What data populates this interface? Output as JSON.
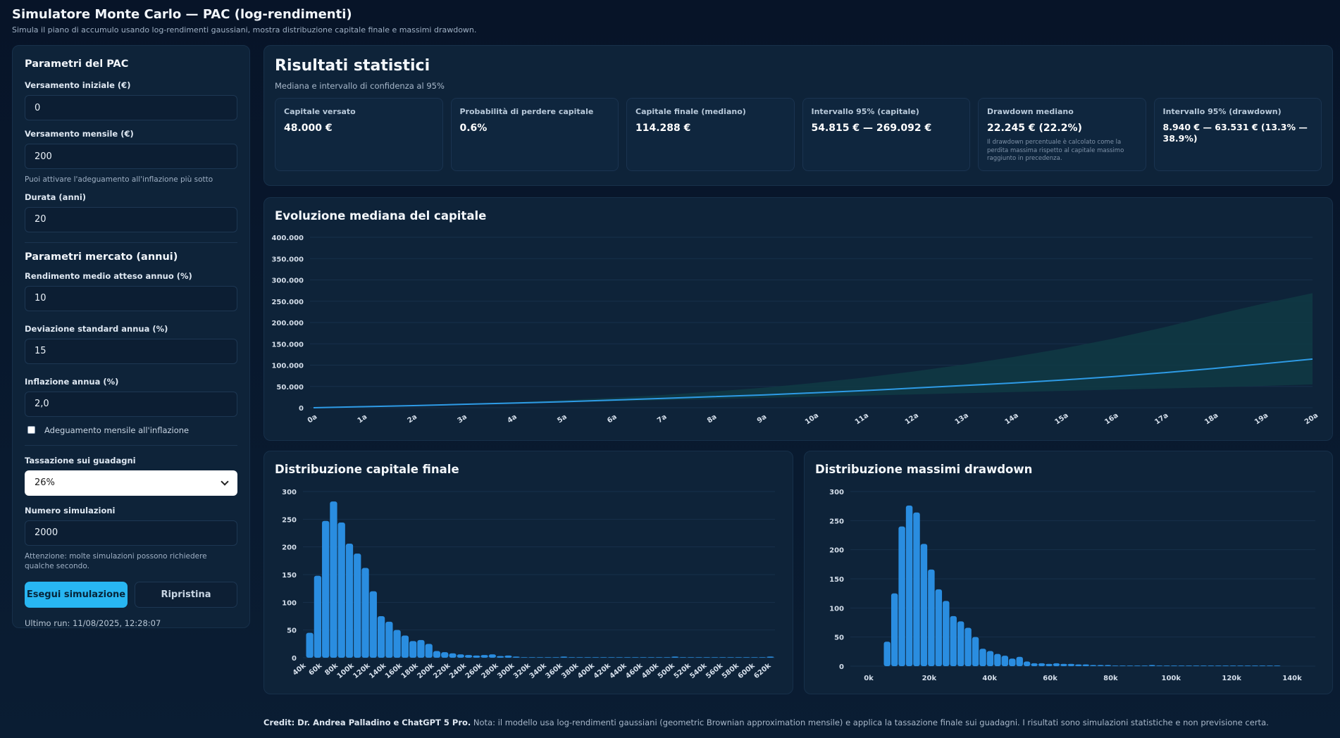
{
  "header": {
    "title": "Simulatore Monte Carlo — PAC (log-rendimenti)",
    "subtitle": "Simula il piano di accumulo usando log-rendimenti gaussiani, mostra distribuzione capitale finale e massimi drawdown."
  },
  "sidebar": {
    "pac_title": "Parametri del PAC",
    "initial_label": "Versamento iniziale (€)",
    "initial_value": "0",
    "monthly_label": "Versamento mensile (€)",
    "monthly_value": "200",
    "monthly_hint": "Puoi attivare l'adeguamento all'inflazione più sotto",
    "duration_label": "Durata (anni)",
    "duration_value": "20",
    "market_title": "Parametri mercato (annui)",
    "return_label": "Rendimento medio atteso annuo (%)",
    "return_value": "10",
    "stddev_label": "Deviazione standard annua (%)",
    "stddev_value": "15",
    "inflation_label": "Inflazione annua (%)",
    "inflation_value": "2,0",
    "inflation_adjust_label": "Adeguamento mensile all'inflazione",
    "tax_label": "Tassazione sui guadagni",
    "tax_value": "26%",
    "sims_label": "Numero simulazioni",
    "sims_value": "2000",
    "sims_hint": "Attenzione: molte simulazioni possono richiedere qualche secondo.",
    "run_button": "Esegui simulazione",
    "reset_button": "Ripristina",
    "last_run": "Ultimo run: 11/08/2025, 12:28:07"
  },
  "stats": {
    "title": "Risultati statistici",
    "subtitle": "Mediana e intervallo di confidenza al 95%",
    "cards": [
      {
        "label": "Capitale versato",
        "value": "48.000 €",
        "note": ""
      },
      {
        "label": "Probabilità di perdere capitale",
        "value": "0.6%",
        "note": ""
      },
      {
        "label": "Capitale finale (mediano)",
        "value": "114.288 €",
        "note": ""
      },
      {
        "label": "Intervallo 95% (capitale)",
        "value": "54.815 € — 269.092 €",
        "note": ""
      },
      {
        "label": "Drawdown mediano",
        "value": "22.245 € (22.2%)",
        "note": "Il drawdown percentuale è calcolato come la perdita massima rispetto al capitale massimo raggiunto in precedenza."
      },
      {
        "label": "Intervallo 95% (drawdown)",
        "value": "8.940 € — 63.531 € (13.3% — 38.9%)",
        "note": ""
      }
    ]
  },
  "chart_data": [
    {
      "type": "area",
      "title": "Evoluzione mediana del capitale",
      "x": [
        "0a",
        "1a",
        "2a",
        "3a",
        "4a",
        "5a",
        "6a",
        "7a",
        "8a",
        "9a",
        "10a",
        "11a",
        "12a",
        "13a",
        "14a",
        "15a",
        "16a",
        "17a",
        "18a",
        "19a",
        "20a"
      ],
      "series": [
        {
          "values": [
            0,
            2500,
            5000,
            8000,
            11000,
            14000,
            18000,
            22000,
            26000,
            30000,
            35000,
            40000,
            46000,
            52000,
            58000,
            65000,
            73000,
            82000,
            92000,
            103000,
            114288
          ]
        }
      ],
      "band_lower": [
        0,
        2400,
        4700,
        7200,
        9800,
        12300,
        15000,
        17600,
        20200,
        23000,
        25800,
        28500,
        31200,
        34000,
        36700,
        39500,
        42300,
        45000,
        48000,
        51000,
        54815
      ],
      "band_upper": [
        0,
        2650,
        5700,
        9200,
        13300,
        18000,
        23500,
        30000,
        38000,
        47000,
        58000,
        70500,
        85000,
        101000,
        119000,
        139000,
        162000,
        188000,
        217000,
        244000,
        269092
      ],
      "yticks": [
        "0",
        "50.000",
        "100.000",
        "150.000",
        "200.000",
        "250.000",
        "300.000",
        "350.000",
        "400.000"
      ],
      "ylim": [
        0,
        400000
      ],
      "colors": {
        "line": "#2e9be6",
        "band": "#0f3a44"
      }
    },
    {
      "type": "bar",
      "title": "Distribuzione capitale finale",
      "categories": [
        "40k",
        "60k",
        "80k",
        "100k",
        "120k",
        "140k",
        "160k",
        "180k",
        "200k",
        "220k",
        "240k",
        "260k",
        "280k",
        "300k",
        "320k",
        "340k",
        "360k",
        "380k",
        "400k",
        "420k",
        "440k",
        "460k",
        "480k",
        "500k",
        "520k",
        "540k",
        "560k",
        "580k",
        "600k",
        "620k"
      ],
      "values": [
        45,
        148,
        247,
        282,
        244,
        206,
        188,
        162,
        120,
        75,
        65,
        50,
        40,
        30,
        32,
        25,
        12,
        10,
        8,
        6,
        5,
        4,
        5,
        6,
        3,
        4,
        2,
        1,
        1,
        1,
        1,
        1,
        2,
        1,
        1,
        1,
        1,
        1,
        1,
        1,
        1,
        1,
        1,
        1,
        1,
        1,
        2,
        1,
        1,
        1,
        1,
        1,
        1,
        1,
        1,
        1,
        1,
        1,
        2
      ],
      "yticks": [
        "0",
        "50",
        "100",
        "150",
        "200",
        "250",
        "300"
      ],
      "ylim": [
        0,
        300
      ],
      "colors": {
        "bar": "#2a8de0"
      }
    },
    {
      "type": "bar",
      "title": "Distribuzione massimi drawdown",
      "categories": [
        "0k",
        "20k",
        "40k",
        "60k",
        "80k",
        "100k",
        "120k",
        "140k"
      ],
      "values": [
        42,
        125,
        240,
        276,
        264,
        210,
        166,
        132,
        112,
        86,
        77,
        66,
        50,
        30,
        26,
        21,
        18,
        13,
        16,
        8,
        5,
        5,
        4,
        5,
        4,
        4,
        3,
        3,
        2,
        2,
        2,
        1,
        1,
        1,
        1,
        1,
        2,
        1,
        1,
        1,
        1,
        1,
        1,
        1,
        1,
        1,
        1,
        1,
        1,
        1,
        1,
        1,
        1,
        1
      ],
      "yticks": [
        "0",
        "50",
        "100",
        "150",
        "200",
        "250",
        "300"
      ],
      "ylim": [
        0,
        300
      ],
      "colors": {
        "bar": "#2a8de0"
      }
    }
  ],
  "footer": {
    "credit": "Credit: Dr. Andrea Palladino e ChatGPT 5 Pro.",
    "note": " Nota: il modello usa log-rendimenti gaussiani (geometric Brownian approximation mensile) e applica la tassazione finale sui guadagni. I risultati sono simulazioni statistiche e non previsione certa."
  }
}
